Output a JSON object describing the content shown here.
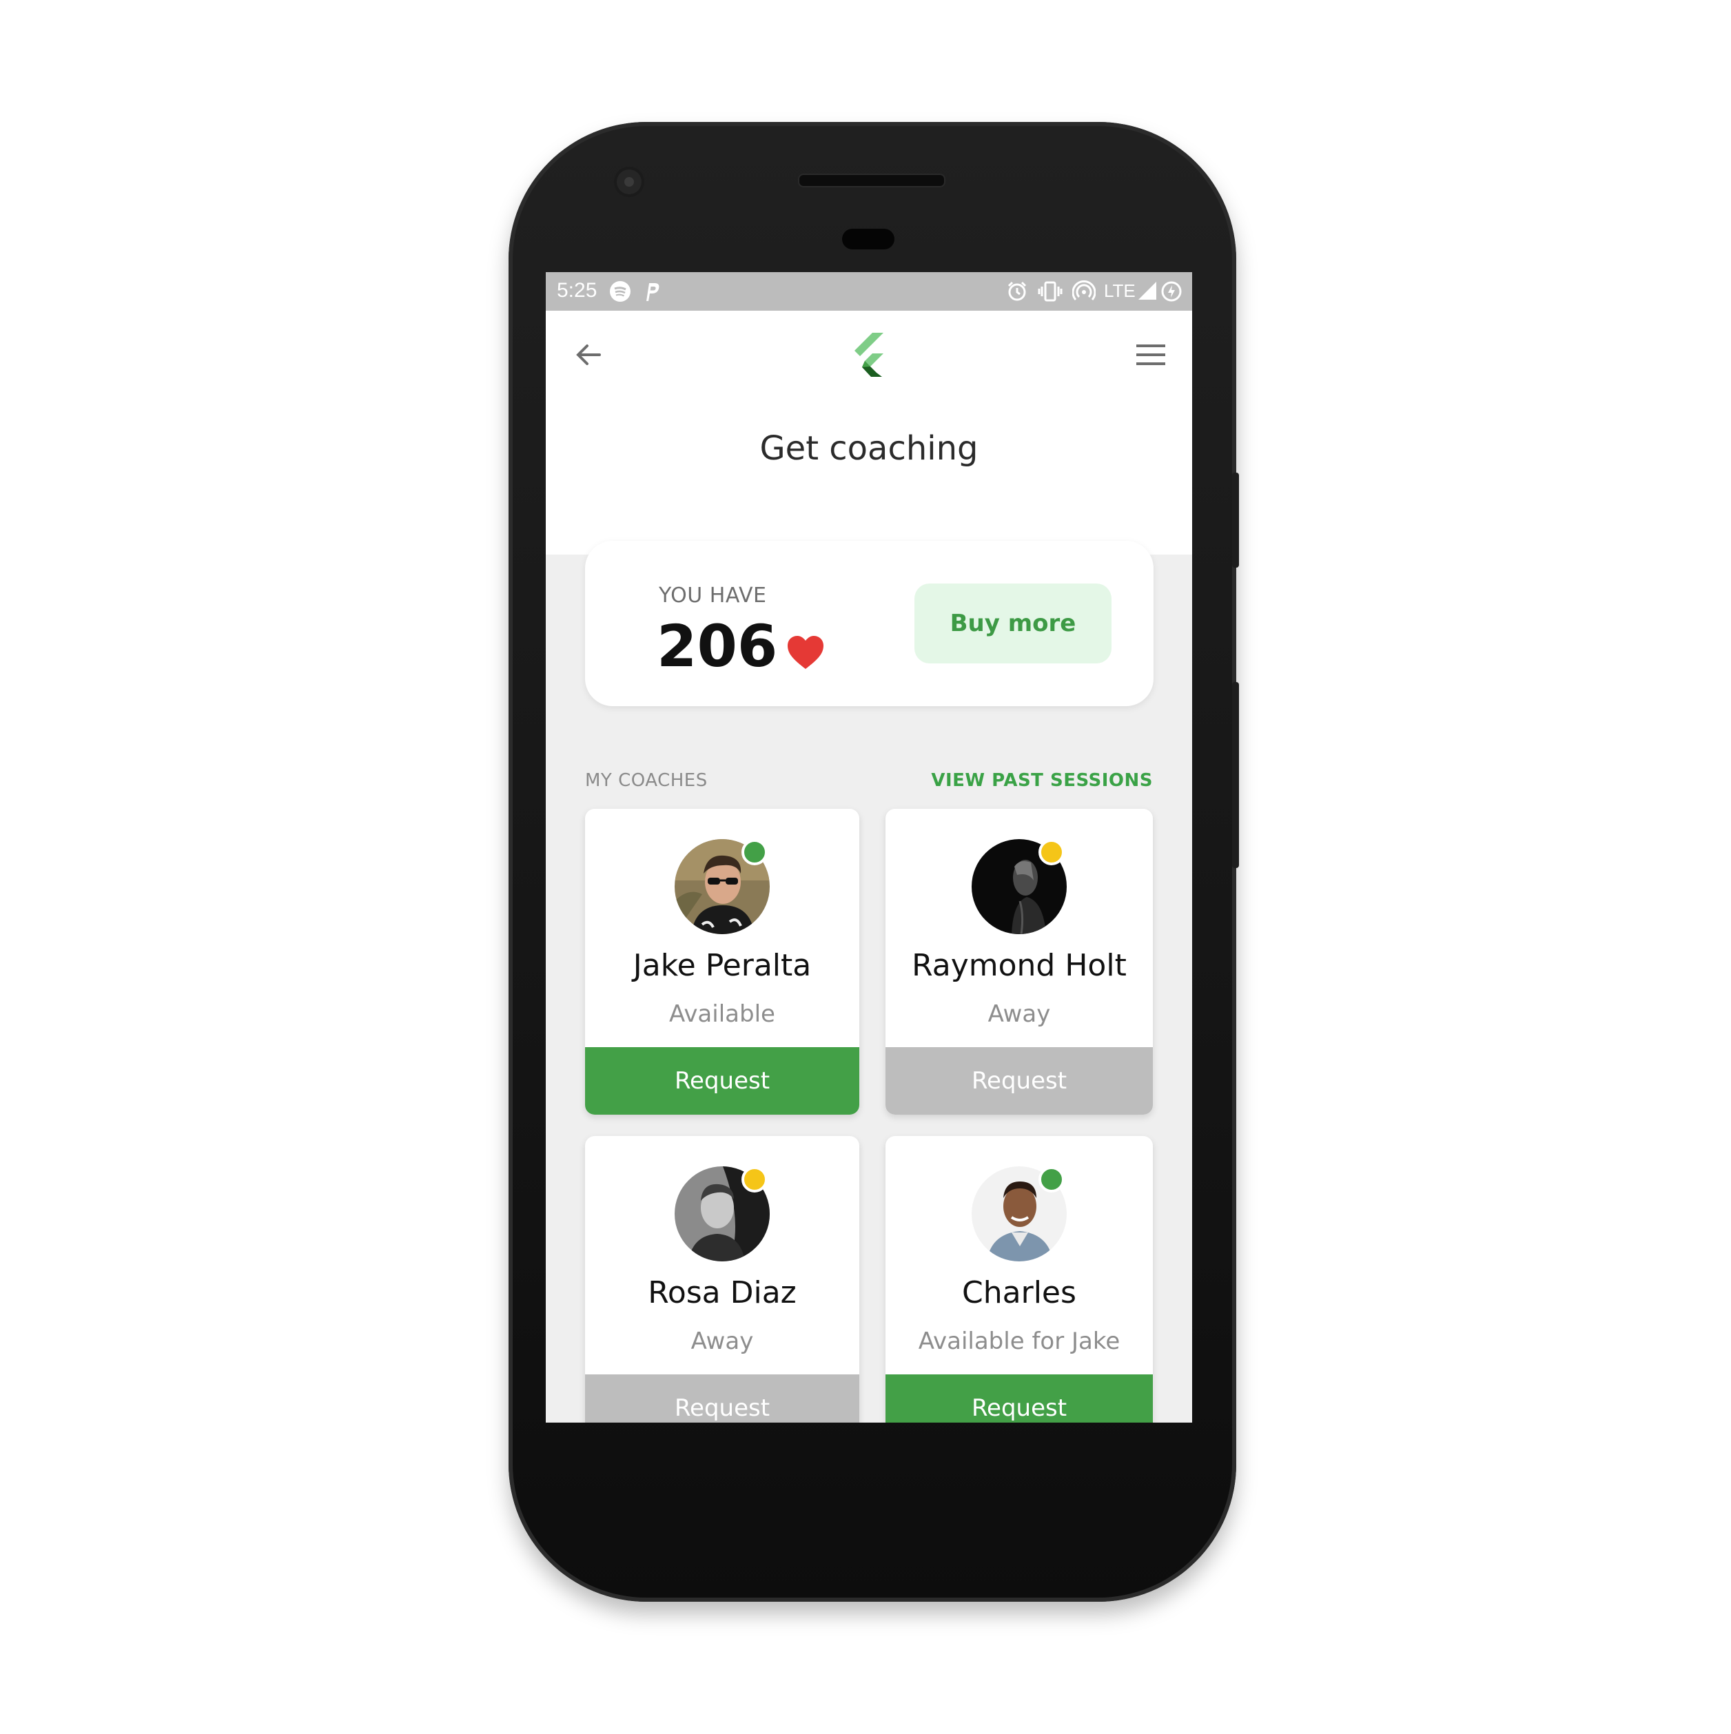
{
  "status_bar": {
    "time": "5:25",
    "network": "LTE"
  },
  "header": {
    "back_icon": "arrow-left-icon",
    "logo": "flutter-logo",
    "menu_icon": "hamburger-menu-icon",
    "title": "Get coaching"
  },
  "credits": {
    "label": "YOU HAVE",
    "value": "206",
    "icon": "heart-icon",
    "buy_label": "Buy more"
  },
  "section": {
    "title": "MY COACHES",
    "link": "VIEW PAST SESSIONS"
  },
  "coaches": [
    {
      "name": "Jake Peralta",
      "status": "Available",
      "indicator": "online",
      "button": "Request",
      "button_state": "active"
    },
    {
      "name": "Raymond Holt",
      "status": "Away",
      "indicator": "away",
      "button": "Request",
      "button_state": "disabled"
    },
    {
      "name": "Rosa Diaz",
      "status": "Away",
      "indicator": "away",
      "button": "Request",
      "button_state": "disabled"
    },
    {
      "name": "Charles",
      "status": "Available for Jake",
      "indicator": "online",
      "button": "Request",
      "button_state": "active"
    }
  ],
  "colors": {
    "accent": "#43a047",
    "online": "#43a047",
    "away": "#f5c518",
    "disabled": "#bdbdbd",
    "buy_bg": "#e4f7e7",
    "heart": "#e53935"
  }
}
